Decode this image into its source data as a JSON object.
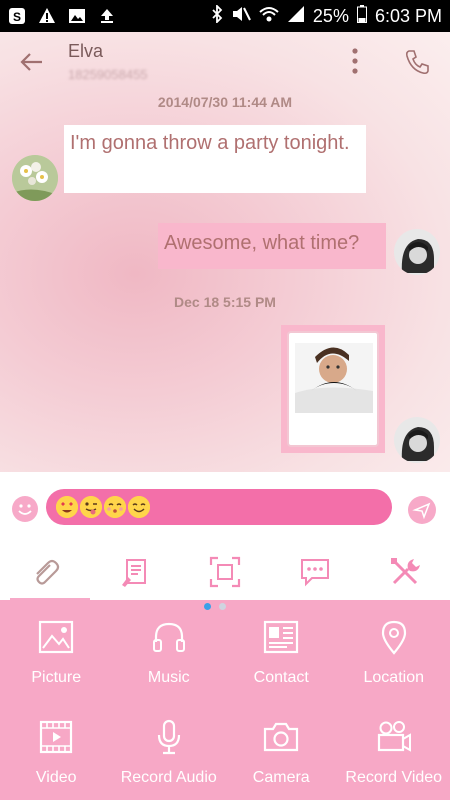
{
  "status": {
    "battery": "25%",
    "time": "6:03 PM"
  },
  "header": {
    "name": "Elva",
    "number": "18259058455"
  },
  "messages": {
    "ts1": "2014/07/30 11:44 AM",
    "incoming": "I'm gonna throw a party tonight.",
    "outgoing": "Awesome, what time?",
    "ts2": "Dec 18 5:15 PM"
  },
  "toolbar": {
    "tools": [
      "attach-icon",
      "draft-icon",
      "screenshot-icon",
      "quick-reply-icon",
      "tools-icon"
    ]
  },
  "attachments": [
    {
      "label": "Picture",
      "icon": "picture-icon"
    },
    {
      "label": "Music",
      "icon": "headphones-icon"
    },
    {
      "label": "Contact",
      "icon": "contact-card-icon"
    },
    {
      "label": "Location",
      "icon": "location-pin-icon"
    },
    {
      "label": "Video",
      "icon": "video-icon"
    },
    {
      "label": "Record Audio",
      "icon": "microphone-icon"
    },
    {
      "label": "Camera",
      "icon": "camera-icon"
    },
    {
      "label": "Record Video",
      "icon": "video-camera-icon"
    }
  ],
  "colors": {
    "accent_pink": "#f7a8c6",
    "input_pink": "#f36fa9",
    "text_rose": "#b07070"
  }
}
